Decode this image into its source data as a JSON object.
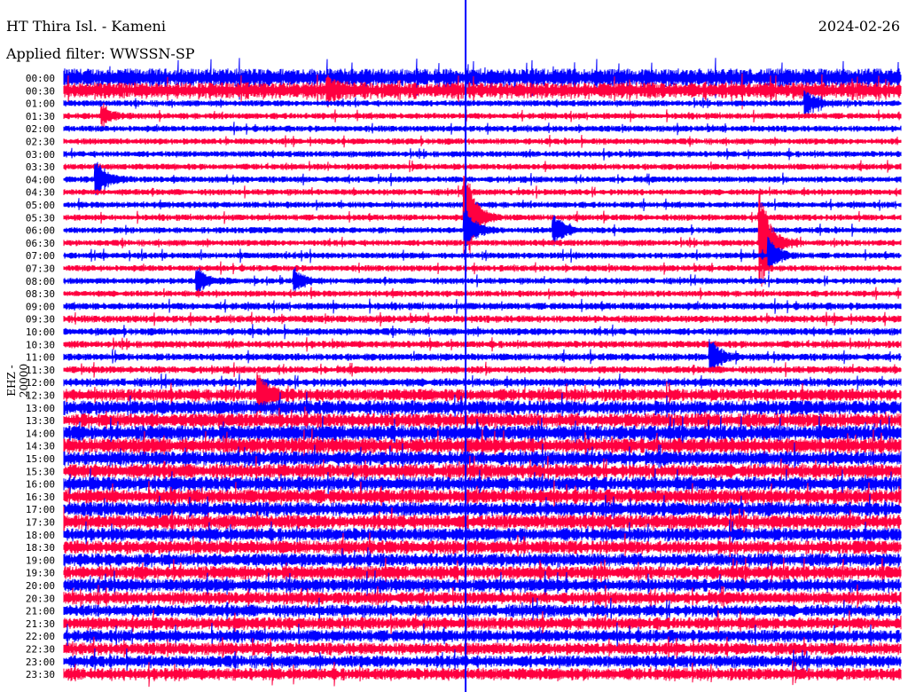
{
  "header": {
    "station": "HT Thira Isl. - Kameni",
    "date": "2024-02-26",
    "filter": "Applied filter: WWSSN-SP",
    "channel": "EHZ - 20000"
  },
  "chart_data": {
    "type": "line",
    "title": "HT Thira Isl. - Kameni",
    "subtitle": "Applied filter: WWSSN-SP",
    "ylabel": "EHZ - 20000",
    "minutes_per_row": 30,
    "row_labels": [
      "00:00",
      "00:30",
      "01:00",
      "01:30",
      "02:00",
      "02:30",
      "03:00",
      "03:30",
      "04:00",
      "04:30",
      "05:00",
      "05:30",
      "06:00",
      "06:30",
      "07:00",
      "07:30",
      "08:00",
      "08:30",
      "09:00",
      "09:30",
      "10:00",
      "10:30",
      "11:00",
      "11:30",
      "12:00",
      "12:30",
      "13:00",
      "13:30",
      "14:00",
      "14:30",
      "15:00",
      "15:30",
      "16:00",
      "16:30",
      "17:00",
      "17:30",
      "18:00",
      "18:30",
      "19:00",
      "19:30",
      "20:00",
      "20:30",
      "21:00",
      "21:30",
      "22:00",
      "22:30",
      "23:00",
      "23:30"
    ],
    "series_colors": [
      "#0000ff",
      "#ff0040"
    ],
    "noise_level": [
      9,
      8,
      3,
      3,
      3,
      3,
      3,
      3,
      3,
      3,
      3,
      3,
      3,
      3,
      3,
      3,
      3,
      3,
      3.5,
      3.5,
      3.5,
      3.5,
      3.5,
      3.5,
      4,
      6,
      7,
      7,
      7.5,
      7.5,
      7,
      7,
      7,
      7,
      7,
      7,
      6.5,
      6.5,
      6.5,
      6.5,
      6.5,
      6,
      6,
      6,
      6,
      6,
      6,
      6
    ],
    "events": [
      {
        "row": 8,
        "minute": 1.2,
        "amp": 22
      },
      {
        "row": 11,
        "minute": 14.4,
        "amp": 60
      },
      {
        "row": 12,
        "minute": 14.4,
        "amp": 25
      },
      {
        "row": 12,
        "minute": 17.6,
        "amp": 18
      },
      {
        "row": 13,
        "minute": 25.0,
        "amp": 60
      },
      {
        "row": 14,
        "minute": 25.3,
        "amp": 20
      },
      {
        "row": 16,
        "minute": 4.8,
        "amp": 16
      },
      {
        "row": 16,
        "minute": 8.3,
        "amp": 12
      },
      {
        "row": 3,
        "minute": 1.4,
        "amp": 10
      },
      {
        "row": 1,
        "minute": 9.5,
        "amp": 12
      },
      {
        "row": 22,
        "minute": 23.2,
        "amp": 20
      },
      {
        "row": 25,
        "minute": 7.0,
        "amp": 22
      },
      {
        "row": 2,
        "minute": 26.6,
        "amp": 14
      }
    ],
    "marker_minute": 14.4
  }
}
